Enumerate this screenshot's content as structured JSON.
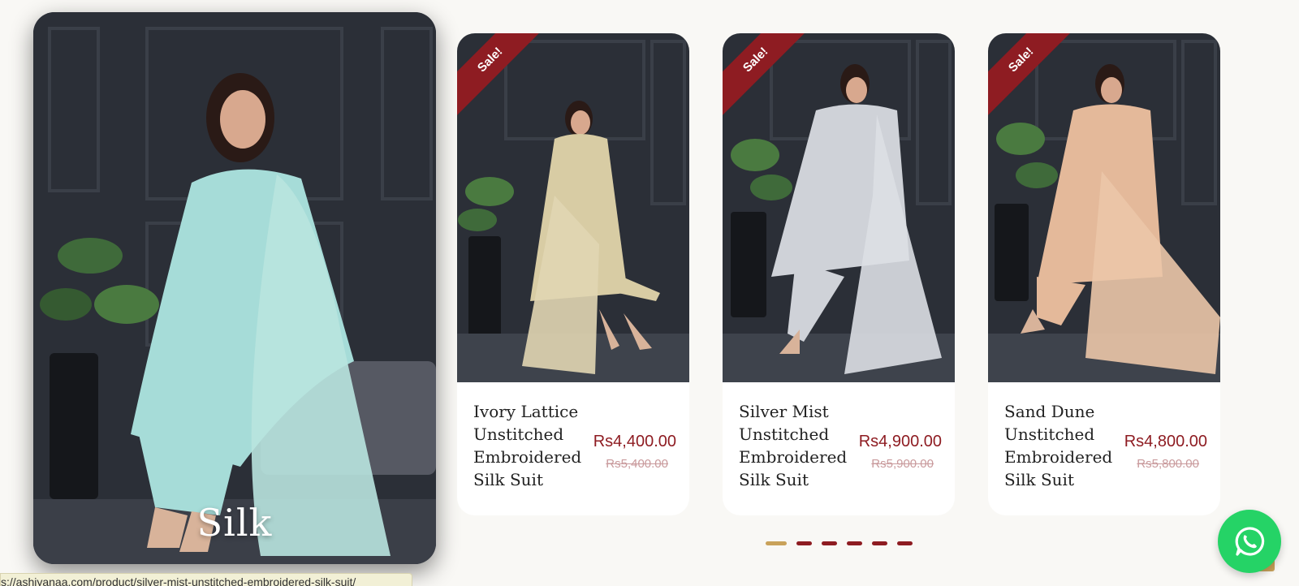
{
  "hero": {
    "title": "Silk"
  },
  "sale_label": "Sale!",
  "products": [
    {
      "name": "Ivory Lattice Unstitched Embroidered Silk Suit",
      "price": "Rs4,400.00",
      "old_price": "Rs5,400.00",
      "outfit_color": "#d8cca4"
    },
    {
      "name": "Silver Mist Unstitched Embroidered Silk Suit",
      "price": "Rs4,900.00",
      "old_price": "Rs5,900.00",
      "outfit_color": "#cfd2d8"
    },
    {
      "name": "Sand Dune Unstitched Embroidered Silk Suit",
      "price": "Rs4,800.00",
      "old_price": "Rs5,800.00",
      "outfit_color": "#e4b99a"
    }
  ],
  "pagination": {
    "total": 6,
    "active": 1
  },
  "status_url": "s://ashiyanaa.com/product/silver-mist-unstitched-embroidered-silk-suit/",
  "colors": {
    "brand": "#8e1c22",
    "accent": "#c9a25a",
    "whatsapp": "#25d366"
  }
}
